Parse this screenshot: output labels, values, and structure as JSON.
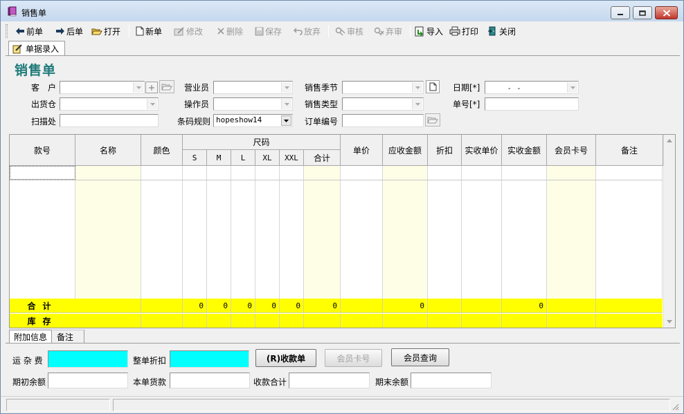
{
  "window": {
    "title": "销售单",
    "minimize_icon": "minimize-icon",
    "maximize_icon": "maximize-icon",
    "close_icon": "close-icon"
  },
  "toolbar": {
    "prev": "前单",
    "next": "后单",
    "open": "打开",
    "new": "新单",
    "edit": "修改",
    "delete": "删除",
    "save": "保存",
    "discard": "放弃",
    "audit": "审核",
    "unaudit": "弃审",
    "import": "导入",
    "print": "打印",
    "close": "关闭"
  },
  "doc_tab": {
    "label": "单据录入"
  },
  "form": {
    "title": "销售单",
    "customer_label": "客　户",
    "customer_value": "",
    "salesperson_label": "营业员",
    "salesperson_value": "",
    "season_label": "销售季节",
    "season_value": "",
    "date_label": "日期[*]",
    "date_value": "　-　-",
    "warehouse_label": "出货仓",
    "warehouse_value": "",
    "operator_label": "操作员",
    "operator_value": "",
    "sales_type_label": "销售类型",
    "sales_type_value": "",
    "doc_no_label": "单号[*]",
    "doc_no_value": "",
    "scan_label": "扫描处",
    "scan_value": "",
    "barcode_rule_label": "条码规则",
    "barcode_rule_value": "hopeshow14",
    "order_no_label": "订单编号",
    "order_no_value": ""
  },
  "grid": {
    "headers": {
      "style_no": "款号",
      "name": "名称",
      "color": "颜色",
      "size_group": "尺码",
      "sizes": [
        "S",
        "M",
        "L",
        "XL",
        "XXL"
      ],
      "size_total": "合计",
      "unit_price": "单价",
      "receivable": "应收金额",
      "discount": "折扣",
      "actual_price": "实收单价",
      "actual_amount": "实收金额",
      "member_card": "会员卡号",
      "remark": "备注"
    },
    "totals_label": "合计",
    "totals": {
      "sizes": [
        "0",
        "0",
        "0",
        "0",
        "0"
      ],
      "size_total": "0",
      "receivable": "0",
      "actual_amount": "0"
    },
    "stock_label": "库存"
  },
  "bottom_tabs": {
    "extra_info": "附加信息",
    "remark": "备注"
  },
  "bottom": {
    "freight_label": "运 杂 费",
    "freight_value": "",
    "whole_discount_label": "整单折扣",
    "whole_discount_value": "",
    "receipt_button": "(R)收款单",
    "member_card_button": "会员卡号",
    "member_query_button": "会员查询",
    "opening_balance_label": "期初余额",
    "opening_balance_value": "",
    "this_order_label": "本单货款",
    "this_order_value": "",
    "received_total_label": "收款合计",
    "received_total_value": "",
    "closing_balance_label": "期末余额",
    "closing_balance_value": ""
  },
  "colors": {
    "accent_title": "#1f7a7a",
    "highlight_input": "#00ffff",
    "totals_row": "#ffff00",
    "yellow_column": "#fefee6"
  }
}
